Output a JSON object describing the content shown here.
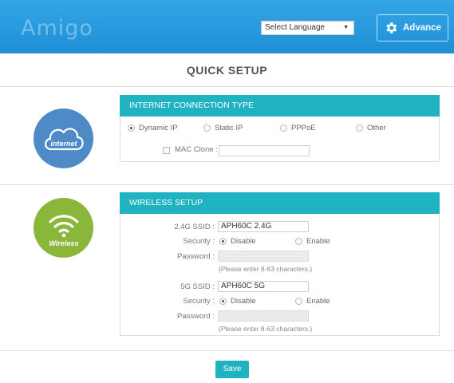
{
  "header": {
    "logo": "Amigo",
    "language_select": {
      "selected": "Select Language"
    },
    "advance_label": "Advance"
  },
  "page_title": "QUICK SETUP",
  "internet_section": {
    "icon_text": "internet",
    "panel_title": "INTERNET CONNECTION TYPE",
    "options": [
      {
        "label": "Dynamic IP",
        "checked": true
      },
      {
        "label": "Static IP",
        "checked": false
      },
      {
        "label": "PPPoE",
        "checked": false
      },
      {
        "label": "Other",
        "checked": false
      }
    ],
    "mac_clone_label": "MAC Clone :",
    "mac_clone_value": ""
  },
  "wireless_section": {
    "icon_text": "Wireless",
    "panel_title": "WIRELESS SETUP",
    "band_24": {
      "ssid_label": "2.4G SSID :",
      "ssid_value": "APH60C 2.4G",
      "security_label": "Security :",
      "disable_label": "Disable",
      "enable_label": "Enable",
      "password_label": "Password :",
      "password_hint": "(Please enter 8-63 characters.)"
    },
    "band_5": {
      "ssid_label": "5G SSID :",
      "ssid_value": "APH60C 5G",
      "security_label": "Security :",
      "disable_label": "Disable",
      "enable_label": "Enable",
      "password_label": "Password :",
      "password_hint": "(Please enter 8-63 characters.)"
    }
  },
  "save_label": "Save",
  "colors": {
    "header": "#2a9ee0",
    "accent": "#1fb3c1",
    "internet_icon": "#4e8ac5",
    "wireless_icon": "#8ab63a"
  }
}
